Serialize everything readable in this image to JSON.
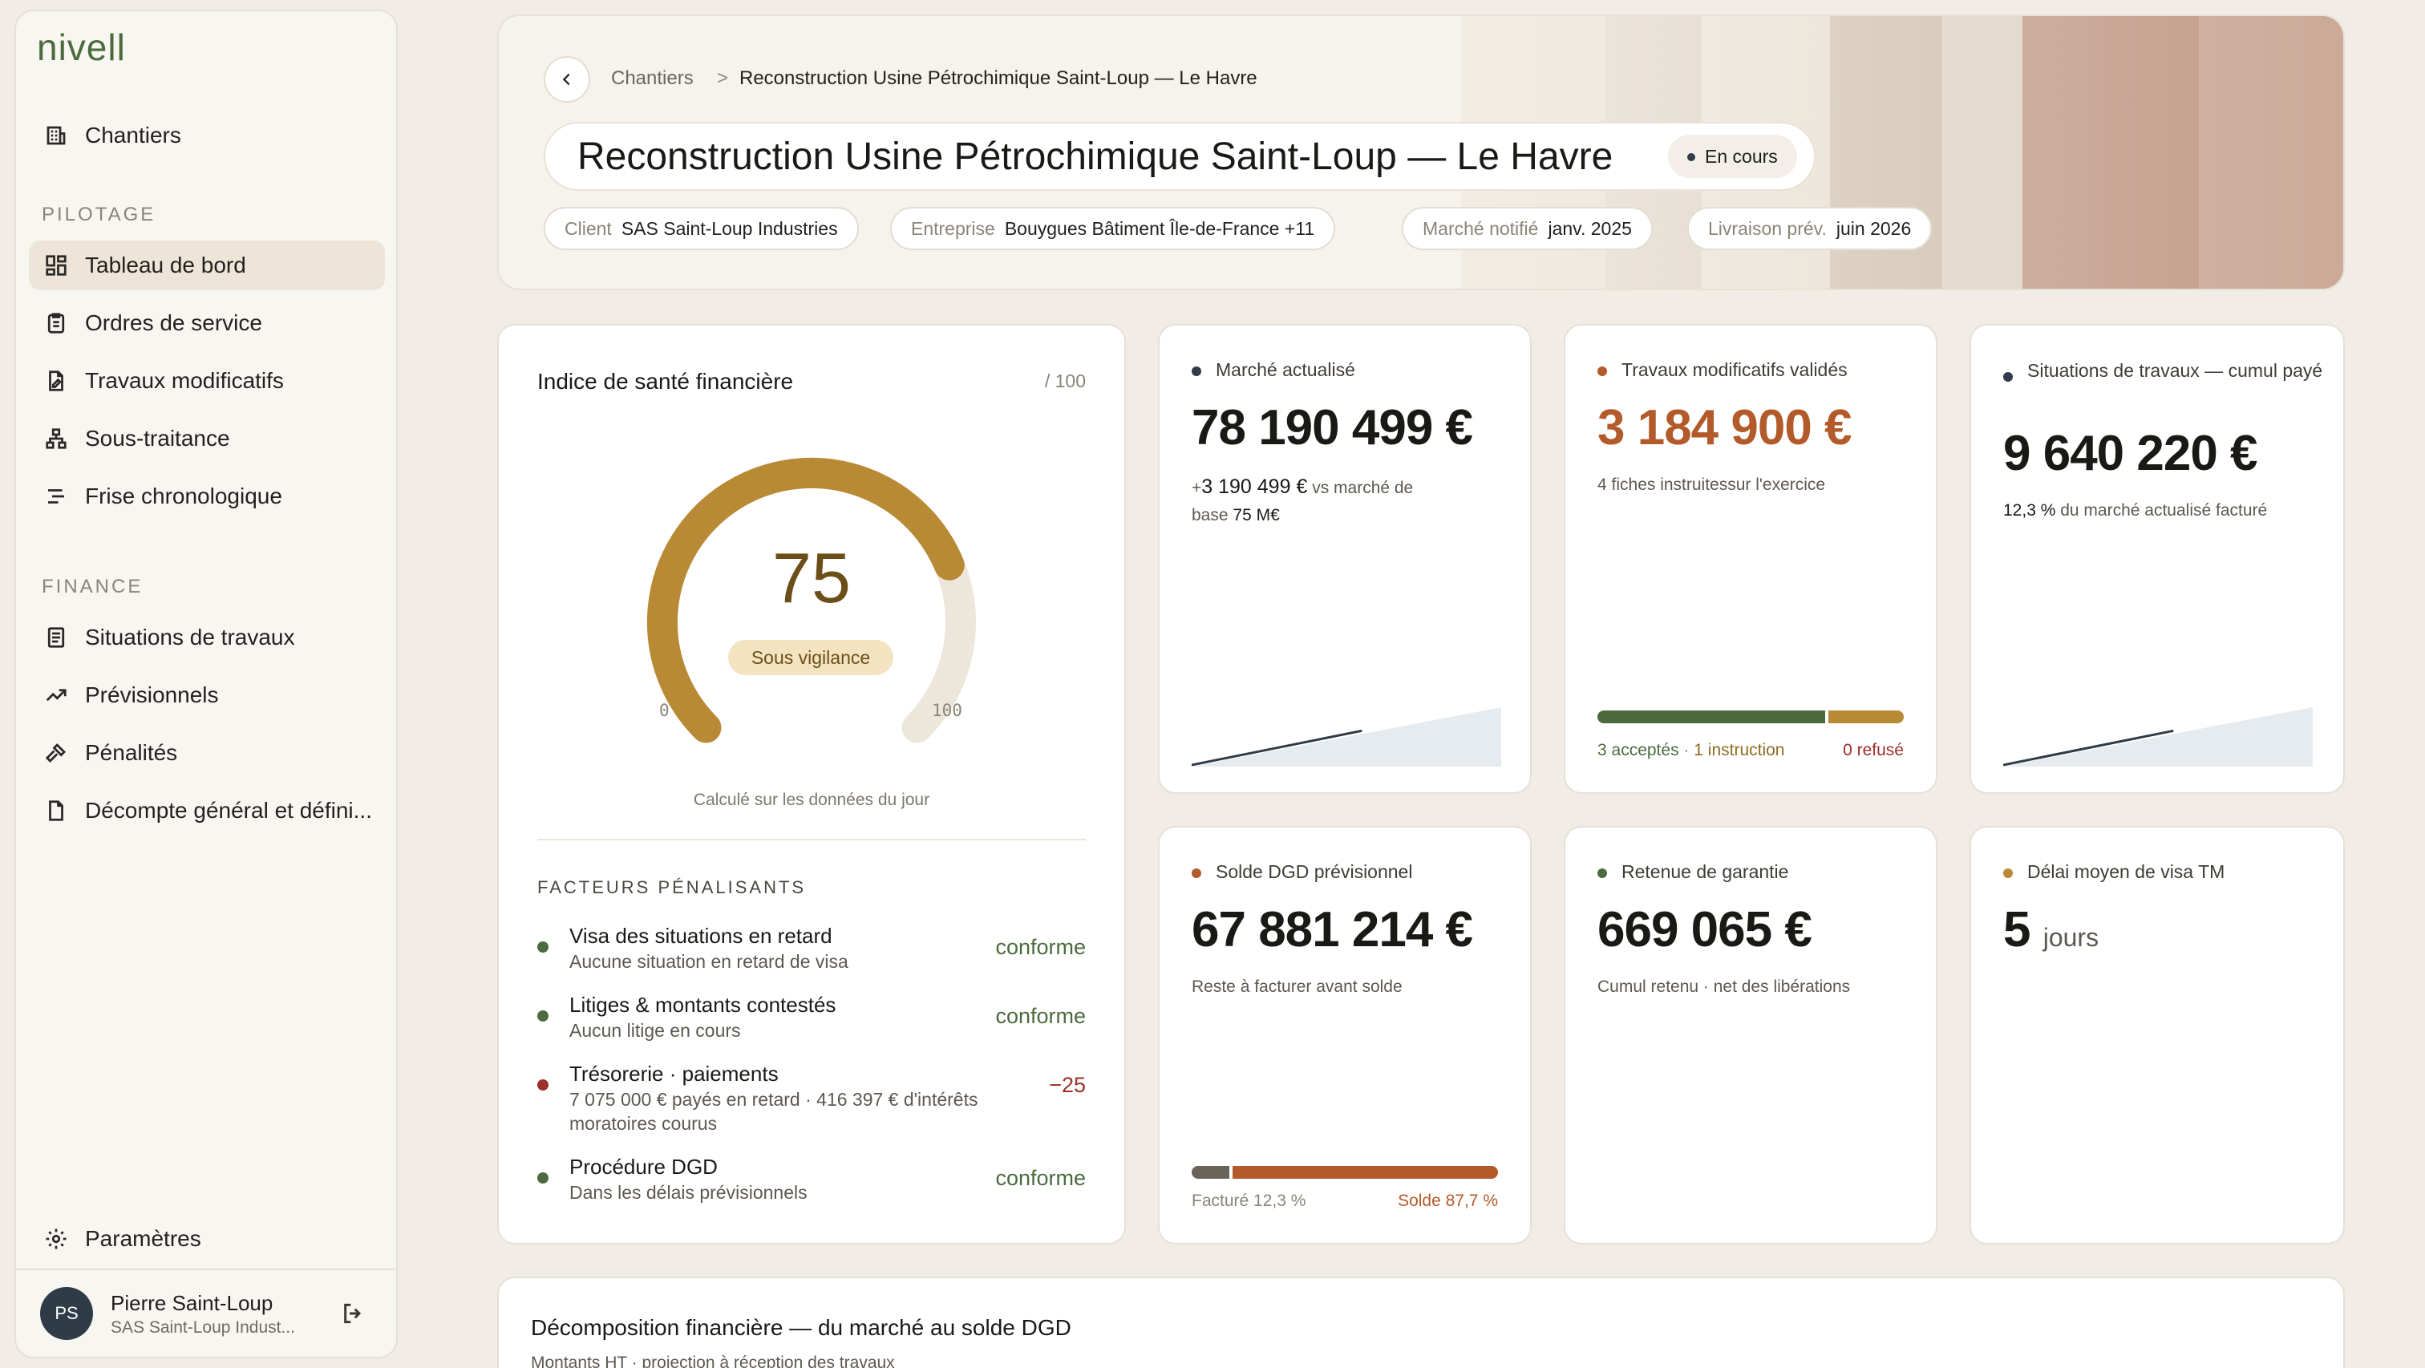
{
  "app": {
    "logo": "nivell"
  },
  "sidebar": {
    "top_item": {
      "label": "Chantiers",
      "icon": "building-icon"
    },
    "sections": [
      {
        "label": "PILOTAGE",
        "items": [
          {
            "label": "Tableau de bord",
            "icon": "dashboard-icon",
            "active": true
          },
          {
            "label": "Ordres de service",
            "icon": "clipboard-icon"
          },
          {
            "label": "Travaux modificatifs",
            "icon": "file-edit-icon"
          },
          {
            "label": "Sous-traitance",
            "icon": "network-icon"
          },
          {
            "label": "Frise chronologique",
            "icon": "timeline-icon"
          }
        ]
      },
      {
        "label": "FINANCE",
        "items": [
          {
            "label": "Situations de travaux",
            "icon": "document-icon"
          },
          {
            "label": "Prévisionnels",
            "icon": "trend-icon"
          },
          {
            "label": "Pénalités",
            "icon": "gavel-icon"
          },
          {
            "label": "Décompte général et défini...",
            "icon": "file-check-icon"
          }
        ]
      }
    ],
    "settings_label": "Paramètres",
    "user": {
      "initials": "PS",
      "name": "Pierre Saint-Loup",
      "org": "SAS Saint-Loup Indust..."
    }
  },
  "header": {
    "breadcrumb": {
      "parent": "Chantiers",
      "separator": ">",
      "current": "Reconstruction Usine Pétrochimique Saint-Loup — Le Havre"
    },
    "title": "Reconstruction Usine Pétrochimique Saint-Loup — Le Havre",
    "status": "En cours",
    "meta": [
      {
        "key": "Client",
        "value": "SAS Saint-Loup Industries"
      },
      {
        "key": "Entreprise",
        "value": "Bouygues Bâtiment Île-de-France +11"
      },
      {
        "key": "Marché notifié",
        "value": "janv. 2025"
      },
      {
        "key": "Livraison prév.",
        "value": "juin 2026"
      }
    ]
  },
  "health": {
    "title": "Indice de santé financière",
    "scale": "/ 100",
    "value": "75",
    "value_num": 75,
    "status": "Sous vigilance",
    "min": "0",
    "max": "100",
    "note": "Calculé sur les données du jour",
    "factors_label": "FACTEURS PÉNALISANTS",
    "factors": [
      {
        "name": "Visa des situations en retard",
        "desc": "Aucune situation en retard de visa",
        "value": "conforme",
        "status": "ok"
      },
      {
        "name": "Litiges & montants contestés",
        "desc": "Aucun litige en cours",
        "value": "conforme",
        "status": "ok"
      },
      {
        "name": "Trésorerie · paiements",
        "desc": "7 075 000 € payés en retard · 416 397 € d'intérêts moratoires courus",
        "value": "−25",
        "status": "bad"
      },
      {
        "name": "Procédure DGD",
        "desc": "Dans les délais prévisionnels",
        "value": "conforme",
        "status": "ok"
      }
    ]
  },
  "kpis": {
    "marche": {
      "label": "Marché actualisé",
      "value": "78 190 499 €",
      "delta": "+3 190 499 €",
      "delta_plus": "+",
      "delta_amount": "3 190 499 €",
      "sub_1": "vs marché de",
      "sub_2": "base",
      "sub_3": "75 M€",
      "sparkline_progress": 0.55
    },
    "travaux": {
      "label": "Travaux modificatifs validés",
      "value": "3 184 900 €",
      "sub": "4 fiches instruitessur l'exercice",
      "accepted": "3 acceptés",
      "instruction": "1 instruction",
      "refused": "0 refusé",
      "sep": "·",
      "counts": {
        "accepted": 3,
        "instruction": 1,
        "refused": 0
      }
    },
    "situations": {
      "label": "Situations de travaux — cumul payé",
      "value": "9 640 220 €",
      "pct": "12,3 %",
      "sub": "du marché actualisé facturé",
      "sparkline_progress": 0.55
    },
    "solde": {
      "label": "Solde DGD prévisionnel",
      "value": "67 881 214 €",
      "sub": "Reste à facturer avant solde",
      "billed": "Facturé 12,3 %",
      "remaining": "Solde 87,7 %",
      "billed_pct": 12.3
    },
    "retenue": {
      "label": "Retenue de garantie",
      "value": "669 065 €",
      "sub": "Cumul retenu · net des libérations"
    },
    "delai": {
      "label": "Délai moyen de visa TM",
      "value": "5",
      "unit": "jours"
    }
  },
  "decomposition": {
    "title": "Décomposition financière — du marché au solde DGD",
    "sub": "Montants HT · projection à réception des travaux"
  },
  "colors": {
    "accent_green": "#4b6b3f",
    "gold": "#b88a35",
    "rust": "#b25a2a",
    "navy": "#2f3c48",
    "bad_red": "#9b2f2a"
  }
}
